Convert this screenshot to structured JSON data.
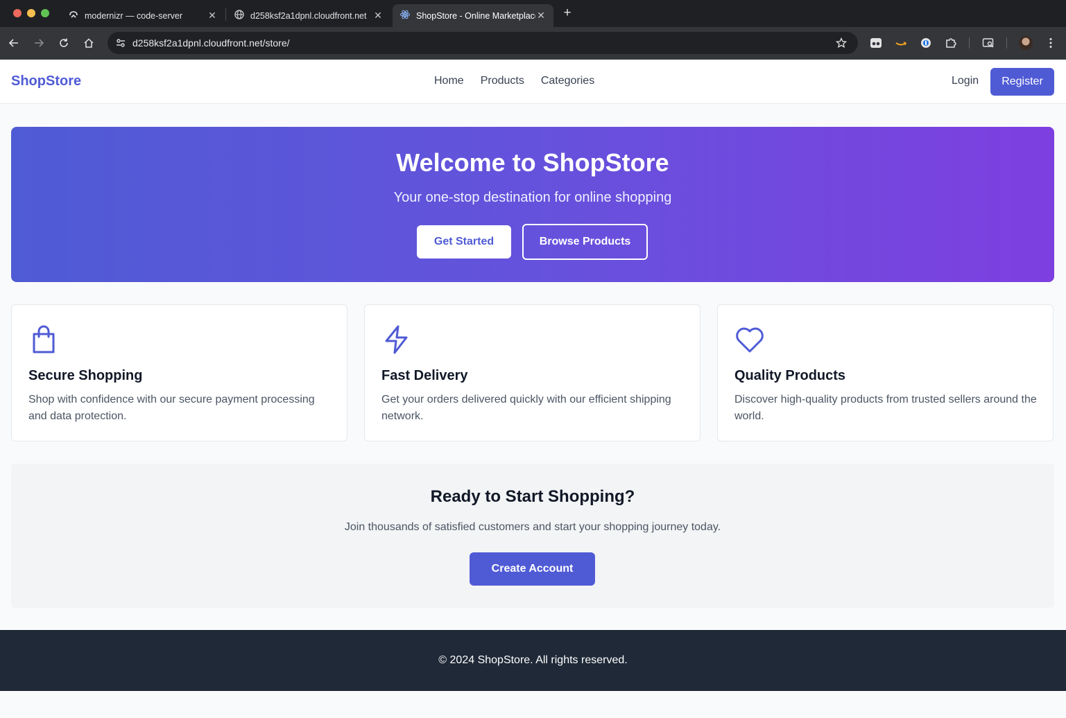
{
  "browser": {
    "tabs": [
      {
        "title": "modernizr — code-server",
        "icon": "code-server-icon"
      },
      {
        "title": "d258ksf2a1dpnl.cloudfront.net",
        "icon": "globe-icon"
      },
      {
        "title": "ShopStore - Online Marketplace",
        "icon": "react-icon",
        "active": true
      }
    ],
    "url_host": "d258ksf2a1dpnl.cloudfront.net",
    "url_path": "/store/"
  },
  "nav": {
    "brand": "ShopStore",
    "links": [
      "Home",
      "Products",
      "Categories"
    ],
    "login": "Login",
    "register": "Register"
  },
  "hero": {
    "title": "Welcome to ShopStore",
    "subtitle": "Your one-stop destination for online shopping",
    "primary_button": "Get Started",
    "secondary_button": "Browse Products"
  },
  "features": [
    {
      "icon": "shopping-bag-icon",
      "title": "Secure Shopping",
      "text": "Shop with confidence with our secure payment processing and data protection."
    },
    {
      "icon": "lightning-bolt-icon",
      "title": "Fast Delivery",
      "text": "Get your orders delivered quickly with our efficient shipping network."
    },
    {
      "icon": "heart-icon",
      "title": "Quality Products",
      "text": "Discover high-quality products from trusted sellers around the world."
    }
  ],
  "cta": {
    "title": "Ready to Start Shopping?",
    "text": "Join thousands of satisfied customers and start your shopping journey today.",
    "button": "Create Account"
  },
  "footer": {
    "text": "© 2024 ShopStore. All rights reserved."
  },
  "colors": {
    "accent": "#4f5bd5",
    "hero_gradient_start": "#4f5bd5",
    "hero_gradient_end": "#7e3fe0",
    "footer_bg": "#1f2937"
  }
}
